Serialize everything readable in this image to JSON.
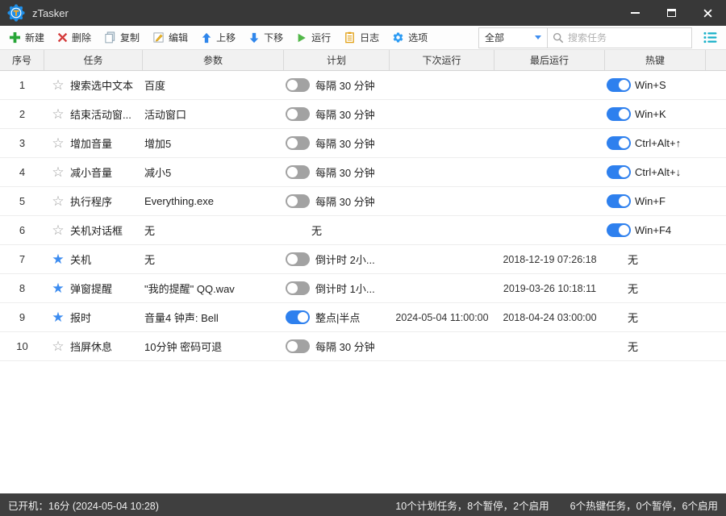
{
  "window": {
    "title": "zTasker",
    "controls": {
      "minimize": "minimize",
      "maximize": "maximize",
      "close": "close"
    }
  },
  "toolbar": {
    "buttons": [
      {
        "label": "新建",
        "icon": "plus-icon"
      },
      {
        "label": "删除",
        "icon": "delete-x-icon"
      },
      {
        "label": "复制",
        "icon": "copy-icon"
      },
      {
        "label": "编辑",
        "icon": "edit-pencil-icon"
      },
      {
        "label": "上移",
        "icon": "arrow-up-icon"
      },
      {
        "label": "下移",
        "icon": "arrow-down-icon"
      },
      {
        "label": "运行",
        "icon": "play-icon"
      },
      {
        "label": "日志",
        "icon": "log-clipboard-icon"
      },
      {
        "label": "选项",
        "icon": "gear-icon"
      }
    ],
    "filter_value": "全部",
    "search_placeholder": "搜索任务",
    "view_icon": "list-icon"
  },
  "table": {
    "columns": [
      "序号",
      "任务",
      "参数",
      "计划",
      "下次运行",
      "最后运行",
      "热键"
    ],
    "rows": [
      {
        "num": "1",
        "starred": false,
        "name": "搜索选中文本",
        "params": "百度",
        "schedule": {
          "toggle": "off",
          "label": "每隔 30 分钟"
        },
        "next_run": "",
        "last_run": "",
        "hotkey": {
          "toggle": "on",
          "label": "Win+S"
        }
      },
      {
        "num": "2",
        "starred": false,
        "name": "结束活动窗...",
        "params": "活动窗口",
        "schedule": {
          "toggle": "off",
          "label": "每隔 30 分钟"
        },
        "next_run": "",
        "last_run": "",
        "hotkey": {
          "toggle": "on",
          "label": "Win+K"
        }
      },
      {
        "num": "3",
        "starred": false,
        "name": "增加音量",
        "params": "增加5",
        "schedule": {
          "toggle": "off",
          "label": "每隔 30 分钟"
        },
        "next_run": "",
        "last_run": "",
        "hotkey": {
          "toggle": "on",
          "label": "Ctrl+Alt+↑"
        }
      },
      {
        "num": "4",
        "starred": false,
        "name": "减小音量",
        "params": "减小5",
        "schedule": {
          "toggle": "off",
          "label": "每隔 30 分钟"
        },
        "next_run": "",
        "last_run": "",
        "hotkey": {
          "toggle": "on",
          "label": "Ctrl+Alt+↓"
        }
      },
      {
        "num": "5",
        "starred": false,
        "name": "执行程序",
        "params": "Everything.exe",
        "schedule": {
          "toggle": "off",
          "label": "每隔 30 分钟"
        },
        "next_run": "",
        "last_run": "",
        "hotkey": {
          "toggle": "on",
          "label": "Win+F"
        }
      },
      {
        "num": "6",
        "starred": false,
        "name": "关机对话框",
        "params": "无",
        "schedule": {
          "toggle": "none",
          "label": "无"
        },
        "next_run": "",
        "last_run": "",
        "hotkey": {
          "toggle": "on",
          "label": "Win+F4"
        }
      },
      {
        "num": "7",
        "starred": true,
        "name": "关机",
        "params": "无",
        "schedule": {
          "toggle": "off",
          "label": "倒计时 2小..."
        },
        "next_run": "",
        "last_run": "2018-12-19 07:26:18",
        "hotkey": {
          "toggle": "none",
          "label": "无"
        }
      },
      {
        "num": "8",
        "starred": true,
        "name": "弹窗提醒",
        "params": "\"我的提醒\" QQ.wav",
        "schedule": {
          "toggle": "off",
          "label": "倒计时 1小..."
        },
        "next_run": "",
        "last_run": "2019-03-26 10:18:11",
        "hotkey": {
          "toggle": "none",
          "label": "无"
        }
      },
      {
        "num": "9",
        "starred": true,
        "name": "报时",
        "params": "音量4 钟声: Bell",
        "schedule": {
          "toggle": "on",
          "label": "整点|半点"
        },
        "next_run": "2024-05-04 11:00:00",
        "last_run": "2018-04-24 03:00:00",
        "hotkey": {
          "toggle": "none",
          "label": "无"
        }
      },
      {
        "num": "10",
        "starred": false,
        "name": "挡屏休息",
        "params": "10分钟 密码可退",
        "schedule": {
          "toggle": "off",
          "label": "每隔 30 分钟"
        },
        "next_run": "",
        "last_run": "",
        "hotkey": {
          "toggle": "none",
          "label": "无"
        }
      }
    ]
  },
  "statusbar": {
    "uptime": "已开机：16分 (2024-05-04 10:28)",
    "plan_summary": "10个计划任务，8个暂停，2个启用",
    "hotkey_summary": "6个热键任务，0个暂停，6个启用"
  },
  "colors": {
    "accent_blue": "#2e80ee",
    "toggle_off_gray": "#a2a2a2",
    "star_blue": "#3c8cf0",
    "titlebar_bg": "#383838",
    "statusbar_bg": "#3f3f3f",
    "list_icon_teal": "#16b0c8",
    "new_green": "#27a537",
    "delete_red": "#d43a3a"
  }
}
